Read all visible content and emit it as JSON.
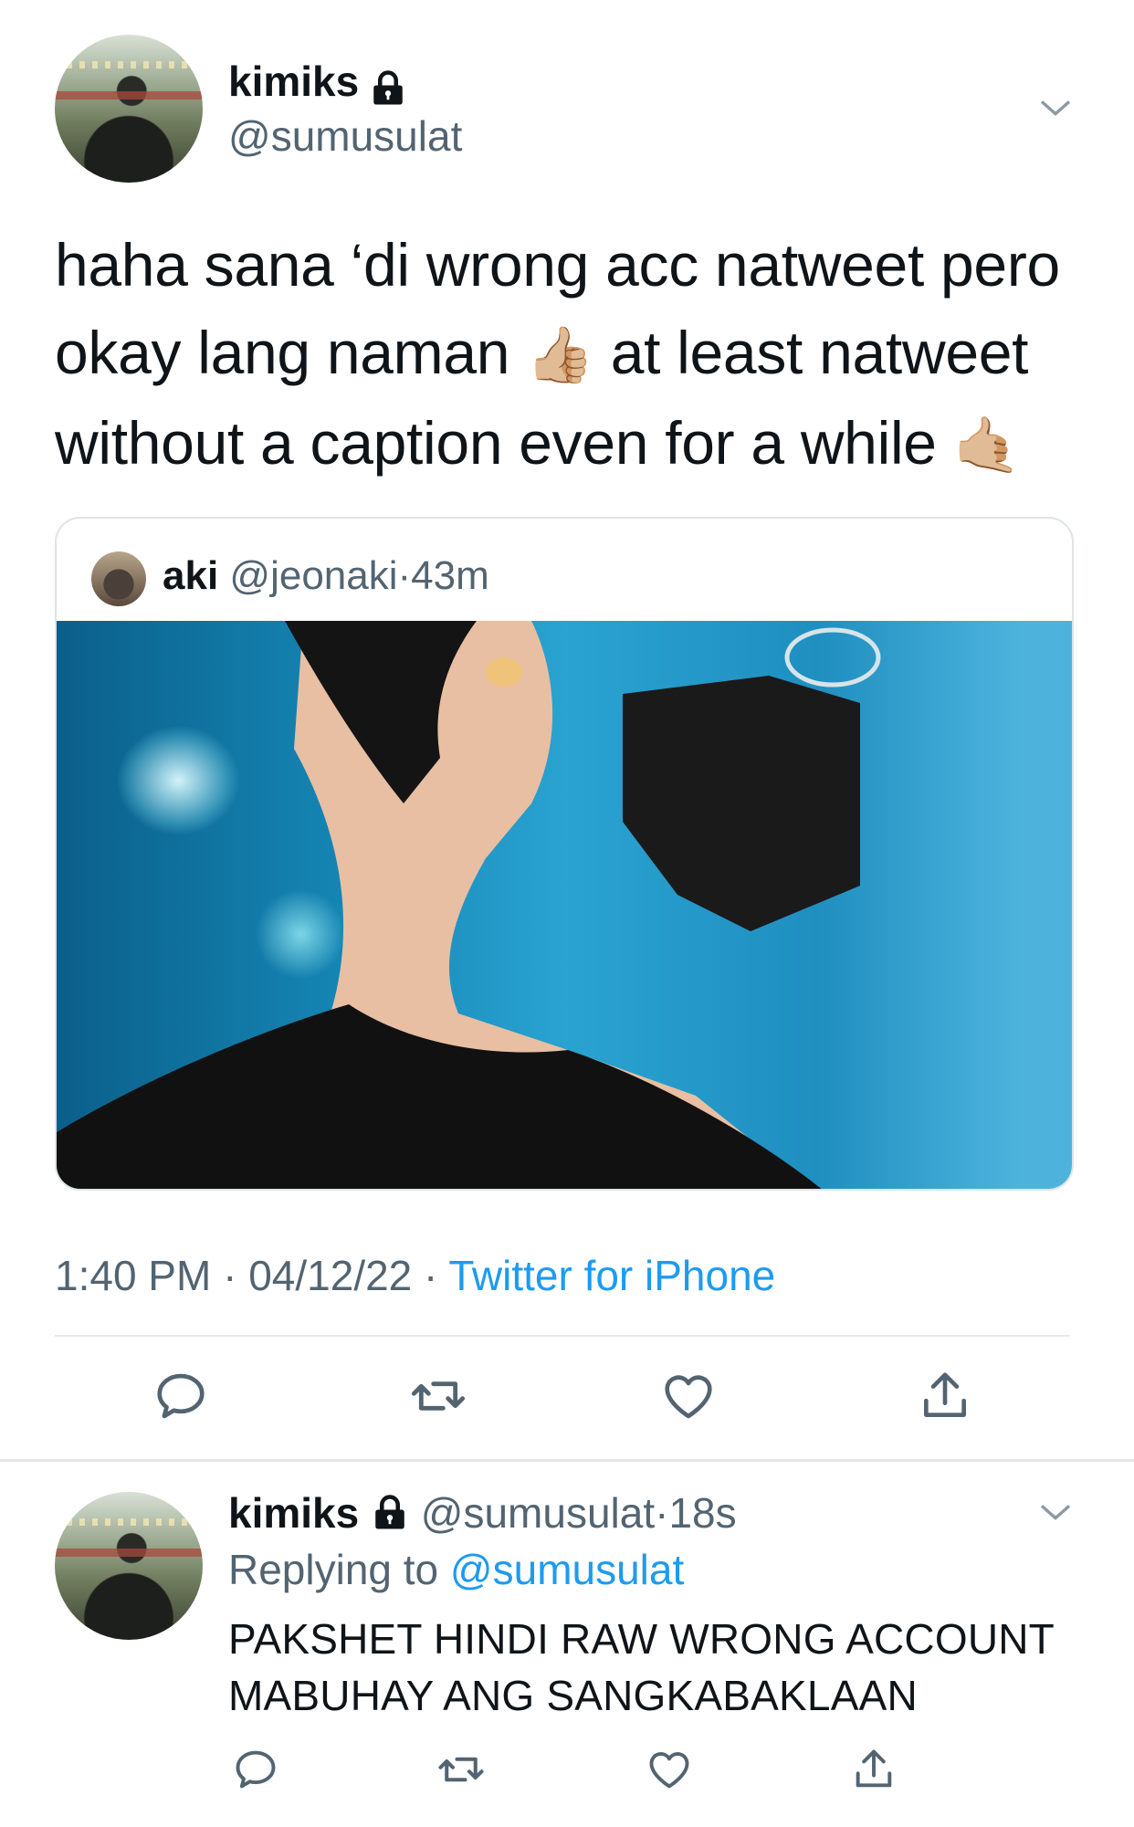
{
  "tweet": {
    "display_name": "kimiks",
    "handle": "@sumusulat",
    "text_line1": "haha sana ‘di wrong acc natweet pero",
    "text_line2_a": "okay lang naman",
    "text_line2_b": "at least natweet",
    "text_line3": "without a caption even for a while",
    "emoji_1": "👍🏼",
    "emoji_2": "🤙🏼",
    "time": "1:40 PM",
    "date": "04/12/22",
    "source": "Twitter for iPhone"
  },
  "quote": {
    "display_name": "aki",
    "handle": "@jeonaki",
    "age": "43m"
  },
  "reply": {
    "display_name": "kimiks",
    "handle": "@sumusulat",
    "age": "18s",
    "replying_prefix": "Replying to",
    "replying_handle": "@sumusulat",
    "text_line1": "PAKSHET HINDI RAW WRONG ACCOUNT",
    "text_line2": "MABUHAY ANG SANGKABAKLAAN"
  },
  "separators": {
    "dot": "·"
  },
  "icons": [
    "lock-icon",
    "chevron-down-icon",
    "reply-icon",
    "retweet-icon",
    "like-icon",
    "share-icon"
  ],
  "colors": {
    "link": "#1d9bf0",
    "secondary": "#536471",
    "text": "#0f1419"
  }
}
